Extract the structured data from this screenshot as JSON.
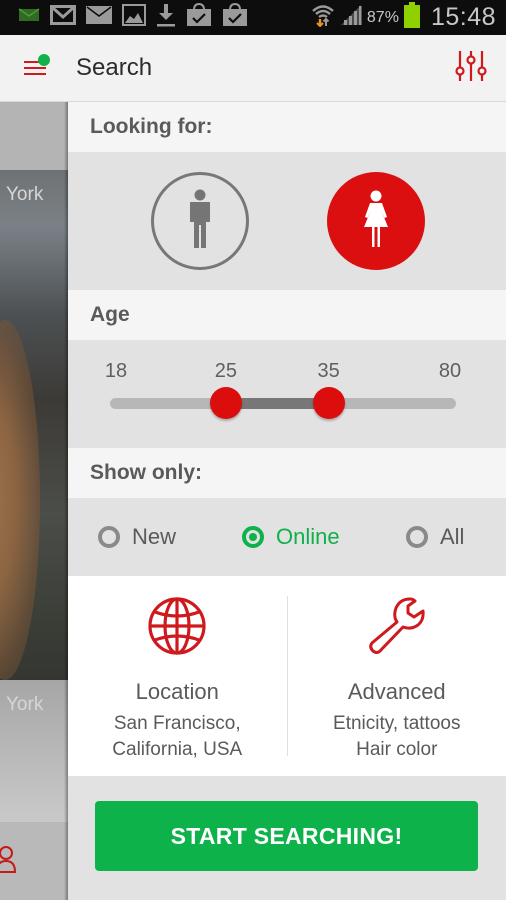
{
  "status_bar": {
    "icons": [
      "sms-icon",
      "gmail-icon",
      "email-icon",
      "gallery-icon",
      "download-icon",
      "play-store-update-icon",
      "play-store-update-icon"
    ],
    "battery_percent": "87%",
    "time": "15:48"
  },
  "toolbar": {
    "title": "Search",
    "menu_icon": "hamburger-menu-icon",
    "notification_dot_color": "#12b24a",
    "filter_icon": "sliders-icon"
  },
  "background_list": {
    "item_1_text": "York",
    "item_2_text": "York"
  },
  "looking_for": {
    "label": "Looking for:",
    "options": [
      {
        "id": "male",
        "icon": "male-icon",
        "selected": false
      },
      {
        "id": "female",
        "icon": "female-icon",
        "selected": true
      }
    ]
  },
  "age": {
    "label": "Age",
    "min": 18,
    "max": 80,
    "low": 25,
    "high": 35,
    "min_label": "18",
    "max_label": "80",
    "low_label": "25",
    "high_label": "35"
  },
  "show_only": {
    "label": "Show only:",
    "options": [
      {
        "label": "New",
        "selected": false
      },
      {
        "label": "Online",
        "selected": true
      },
      {
        "label": "All",
        "selected": false
      }
    ]
  },
  "location": {
    "icon": "globe-icon",
    "title": "Location",
    "line1": "San Francisco,",
    "line2": "California, USA"
  },
  "advanced": {
    "icon": "wrench-icon",
    "title": "Advanced",
    "line1": "Etnicity, tattoos",
    "line2": "Hair color"
  },
  "cta": {
    "label": "START SEARCHING!"
  },
  "colors": {
    "accent_red": "#db0f0f",
    "accent_green": "#0eb24b"
  }
}
